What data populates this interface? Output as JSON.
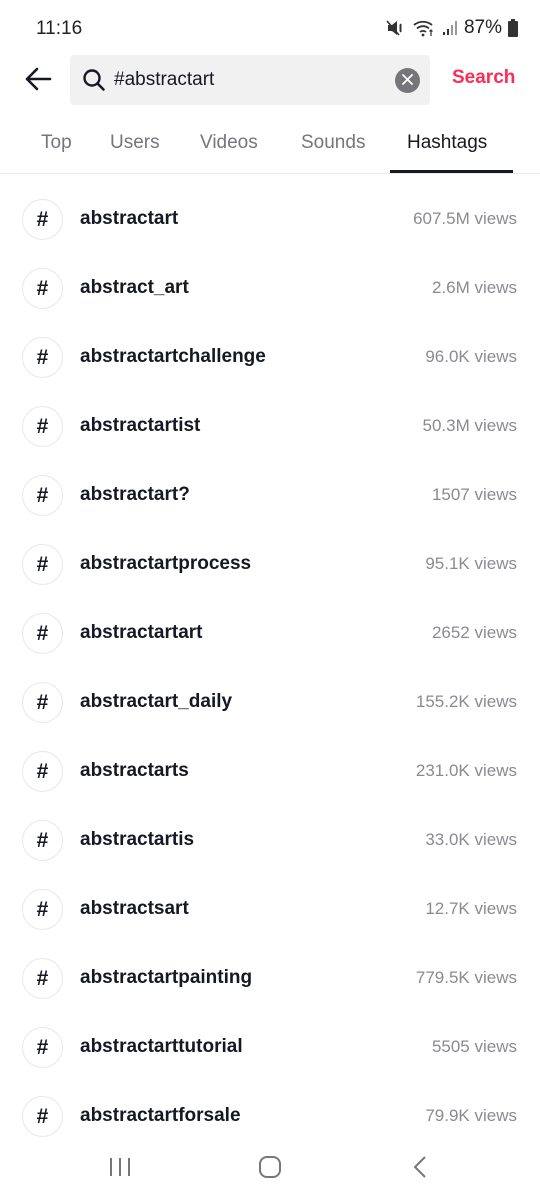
{
  "status_bar": {
    "time": "11:16",
    "battery_percent": "87%",
    "icons": [
      "mute-icon",
      "wifi-icon",
      "signal-icon",
      "battery-icon"
    ]
  },
  "search": {
    "back_icon": "arrow-left-icon",
    "search_icon": "magnifier-icon",
    "query": "#abstractart",
    "clear_icon": "close-circle-icon",
    "submit_label": "Search"
  },
  "tabs": [
    {
      "label": "Top",
      "active": false
    },
    {
      "label": "Users",
      "active": false
    },
    {
      "label": "Videos",
      "active": false
    },
    {
      "label": "Sounds",
      "active": false
    },
    {
      "label": "Hashtags",
      "active": true
    }
  ],
  "hashtags": [
    {
      "icon": "#",
      "name": "abstractart",
      "views": "607.5M views"
    },
    {
      "icon": "#",
      "name": "abstract_art",
      "views": "2.6M views"
    },
    {
      "icon": "#",
      "name": "abstractartchallenge",
      "views": "96.0K views"
    },
    {
      "icon": "#",
      "name": "abstractartist",
      "views": "50.3M views"
    },
    {
      "icon": "#",
      "name": "abstractart?",
      "views": "1507 views"
    },
    {
      "icon": "#",
      "name": "abstractartprocess",
      "views": "95.1K views"
    },
    {
      "icon": "#",
      "name": "abstractartart",
      "views": "2652 views"
    },
    {
      "icon": "#",
      "name": "abstractart_daily",
      "views": "155.2K views"
    },
    {
      "icon": "#",
      "name": "abstractarts",
      "views": "231.0K views"
    },
    {
      "icon": "#",
      "name": "abstractartis",
      "views": "33.0K views"
    },
    {
      "icon": "#",
      "name": "abstractsart",
      "views": "12.7K views"
    },
    {
      "icon": "#",
      "name": "abstractartpainting",
      "views": "779.5K views"
    },
    {
      "icon": "#",
      "name": "abstractarttutorial",
      "views": "5505 views"
    },
    {
      "icon": "#",
      "name": "abstractartforsale",
      "views": "79.9K views"
    }
  ],
  "nav_bar": {
    "buttons": [
      "recents-icon",
      "home-icon",
      "back-icon"
    ]
  },
  "colors": {
    "accent": "#fe2c55",
    "text_primary": "#161823",
    "text_secondary": "#8a8b91",
    "search_bg": "#f1f1f2"
  }
}
